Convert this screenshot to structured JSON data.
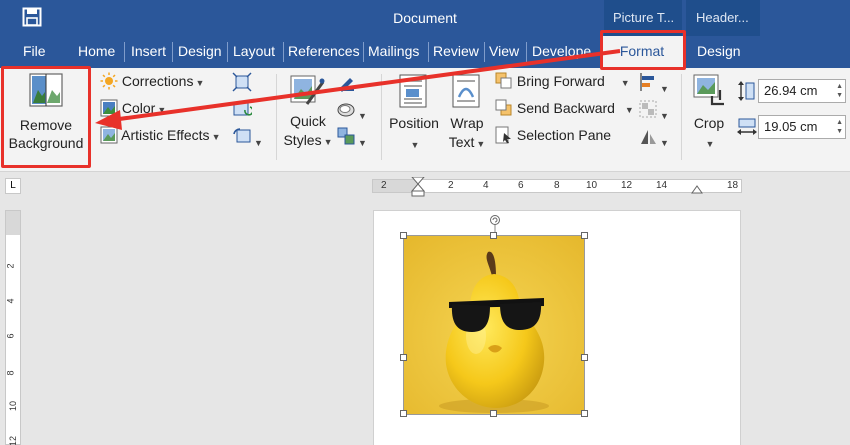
{
  "titlebar": {
    "document_title": "Document",
    "context_picture": "Picture T...",
    "context_header": "Header..."
  },
  "tabs": [
    "File",
    "Home",
    "Insert",
    "Design",
    "Layout",
    "References",
    "Mailings",
    "Review",
    "View",
    "Develope"
  ],
  "context_tabs": {
    "format": "Format",
    "design": "Design"
  },
  "ribbon": {
    "remove_bg_line1": "Remove",
    "remove_bg_line2": "Background",
    "corrections": "Corrections",
    "color": "Color",
    "artistic_effects": "Artistic Effects",
    "quick_styles_1": "Quick",
    "quick_styles_2": "Styles",
    "position": "Position",
    "wrap_text_1": "Wrap",
    "wrap_text_2": "Text",
    "bring_forward": "Bring Forward",
    "send_backward": "Send Backward",
    "selection_pane": "Selection Pane",
    "crop": "Crop",
    "height_value": "26.94 cm",
    "width_value": "19.05 cm"
  },
  "ruler_h": [
    "2",
    "2",
    "4",
    "6",
    "8",
    "10",
    "12",
    "14",
    "18"
  ],
  "ruler_v": [
    "2",
    "4",
    "6",
    "8",
    "10",
    "12"
  ],
  "tab_stop": "L",
  "colors": {
    "accent": "#2b579a",
    "highlight": "#e8312a"
  }
}
